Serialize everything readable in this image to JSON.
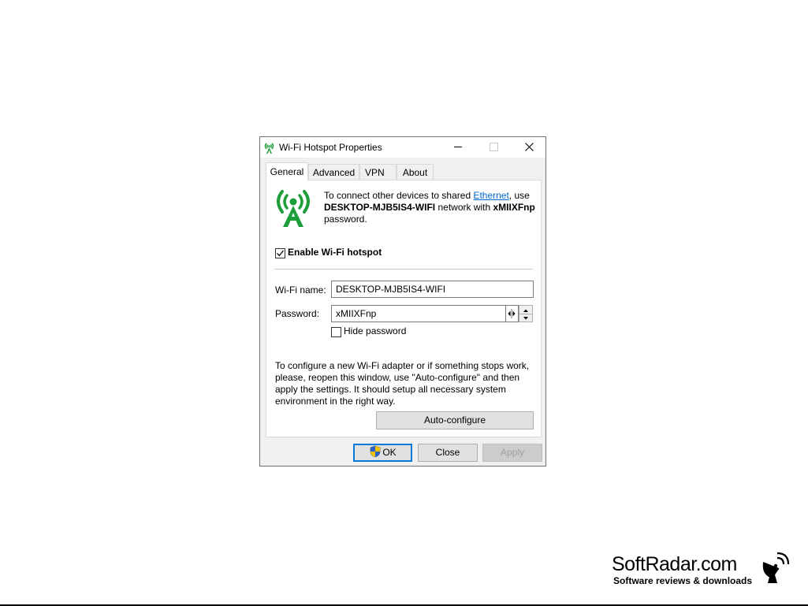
{
  "window": {
    "title": "Wi-Fi Hotspot Properties"
  },
  "tabs": [
    {
      "label": "General"
    },
    {
      "label": "Advanced"
    },
    {
      "label": "VPN"
    },
    {
      "label": "About"
    }
  ],
  "general": {
    "info": {
      "prefix": "To connect other devices to shared ",
      "link": "Ethernet",
      "mid1": ", use ",
      "network": "DESKTOP-MJB5IS4-WIFI",
      "mid2": " network with ",
      "password": "xMIIXFnp",
      "suffix": " password."
    },
    "enable_label": "Enable Wi-Fi hotspot",
    "enable_checked": true,
    "name_label": "Wi-Fi name:",
    "name_value": "DESKTOP-MJB5IS4-WIFI",
    "password_label": "Password:",
    "password_value": "xMIIXFnp",
    "hide_label": "Hide password",
    "hide_checked": false,
    "help_text": "To configure a new Wi-Fi adapter or if something stops work, please, reopen this window, use \"Auto-configure\" and then apply the settings. It should setup all necessary system environment in the right way.",
    "auto_button": "Auto-configure"
  },
  "footer": {
    "ok": "OK",
    "close": "Close",
    "apply": "Apply"
  },
  "watermark": {
    "name": "SoftRadar.com",
    "tagline": "Software reviews & downloads"
  },
  "colors": {
    "accent": "#0078d7",
    "icon_green": "#1e9e3a",
    "link": "#0066cc"
  }
}
